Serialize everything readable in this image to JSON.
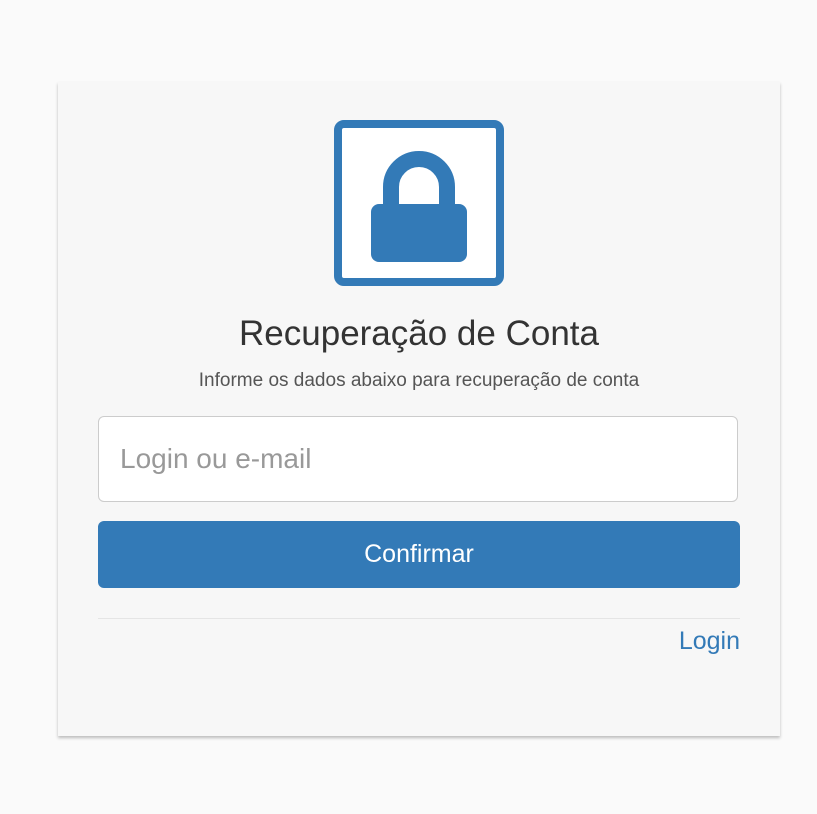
{
  "form": {
    "icon": "lock-icon",
    "title": "Recuperação de Conta",
    "subtitle": "Informe os dados abaixo para recuperação de conta",
    "input_value": "",
    "input_placeholder": "Login ou e-mail",
    "confirm_label": "Confirmar",
    "login_link_label": "Login"
  },
  "colors": {
    "primary": "#337ab7",
    "card_background": "#f7f7f7",
    "page_background": "#fafafa"
  }
}
